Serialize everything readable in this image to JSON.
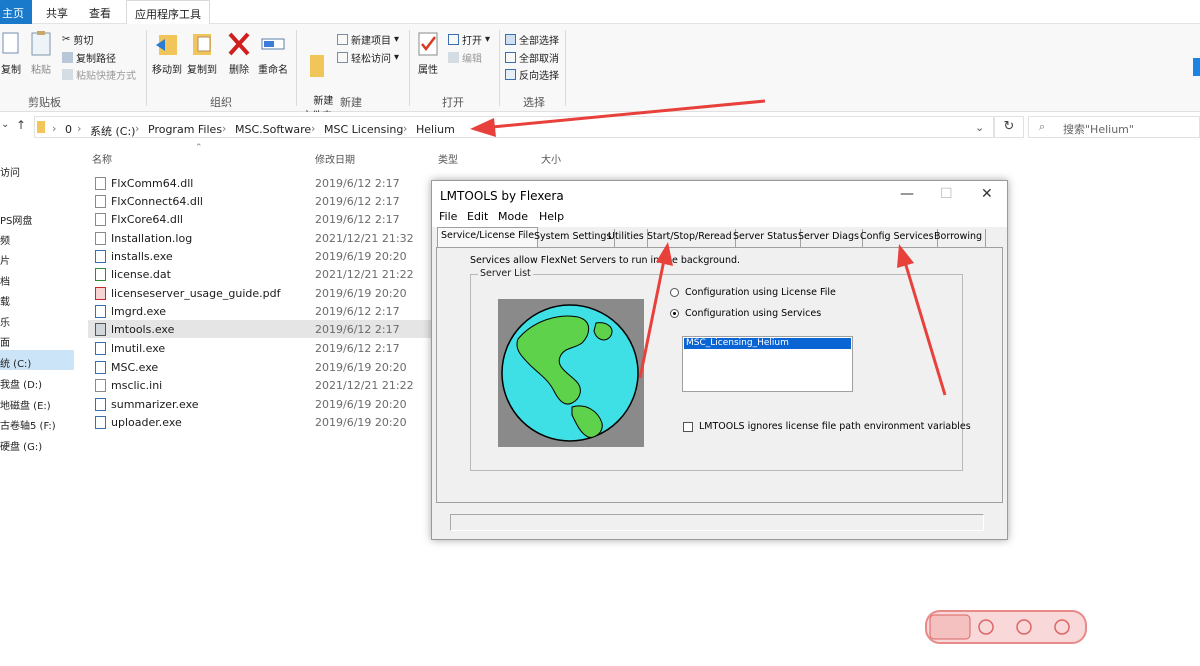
{
  "ribbon_tabs": [
    "主页",
    "共享",
    "查看",
    "应用程序工具"
  ],
  "ribbon": {
    "clipboard": {
      "copy": "复制",
      "paste": "粘贴",
      "cut": "剪切",
      "copy_path": "复制路径",
      "paste_shortcut": "粘贴快捷方式",
      "label": "剪贴板"
    },
    "organize": {
      "move_to": "移动到",
      "copy_to": "复制到",
      "delete": "删除",
      "rename": "重命名",
      "label": "组织"
    },
    "new": {
      "new_folder": "新建\n文件夹",
      "new_item": "新建项目",
      "easy_access": "轻松访问",
      "label": "新建"
    },
    "open": {
      "properties": "属性",
      "open": "打开",
      "edit": "编辑",
      "label": "打开"
    },
    "select": {
      "select_all": "全部选择",
      "select_none": "全部取消",
      "invert": "反向选择",
      "label": "选择"
    }
  },
  "address": {
    "crumbs": [
      "0",
      "系统 (C:)",
      "Program Files",
      "MSC.Software",
      "MSC Licensing",
      "Helium"
    ],
    "search_placeholder": "搜索\"Helium\""
  },
  "nav": [
    "访问",
    "PS网盘",
    "频",
    "片",
    "档",
    "载",
    "乐",
    "面",
    "统 (C:)",
    "我盘 (D:)",
    "地磁盘 (E:)",
    "古卷轴5 (F:)",
    "硬盘 (G:)"
  ],
  "columns": {
    "name": "名称",
    "date": "修改日期",
    "type": "类型",
    "size": "大小"
  },
  "files": [
    {
      "name": "FlxComm64.dll",
      "date": "2019/6/12 2:17"
    },
    {
      "name": "FlxConnect64.dll",
      "date": "2019/6/12 2:17"
    },
    {
      "name": "FlxCore64.dll",
      "date": "2019/6/12 2:17"
    },
    {
      "name": "Installation.log",
      "date": "2021/12/21 21:32"
    },
    {
      "name": "installs.exe",
      "date": "2019/6/19 20:20"
    },
    {
      "name": "license.dat",
      "date": "2021/12/21 21:22"
    },
    {
      "name": "licenseserver_usage_guide.pdf",
      "date": "2019/6/19 20:20"
    },
    {
      "name": "lmgrd.exe",
      "date": "2019/6/12 2:17"
    },
    {
      "name": "lmtools.exe",
      "date": "2019/6/12 2:17"
    },
    {
      "name": "lmutil.exe",
      "date": "2019/6/12 2:17"
    },
    {
      "name": "MSC.exe",
      "date": "2019/6/19 20:20"
    },
    {
      "name": "msclic.ini",
      "date": "2021/12/21 21:22"
    },
    {
      "name": "summarizer.exe",
      "date": "2019/6/19 20:20"
    },
    {
      "name": "uploader.exe",
      "date": "2019/6/19 20:20"
    }
  ],
  "lmtools": {
    "title": "LMTOOLS by Flexera",
    "menu": [
      "File",
      "Edit",
      "Mode",
      "Help"
    ],
    "tabs": [
      "Service/License File",
      "System Settings",
      "Utilities",
      "Start/Stop/Reread",
      "Server Status",
      "Server Diags",
      "Config Services",
      "Borrowing"
    ],
    "services_text": "Services allow FlexNet Servers to run in the background.",
    "server_list_label": "Server List",
    "radio_license_file": "Configuration using License File",
    "radio_services": "Configuration using Services",
    "service_selected": "MSC_Licensing_Helium",
    "checkbox_label": "LMTOOLS ignores license file path environment variables"
  },
  "colors": {
    "accent": "#1979ca",
    "arrow": "#e8413c",
    "selection": "#0a64d4"
  }
}
